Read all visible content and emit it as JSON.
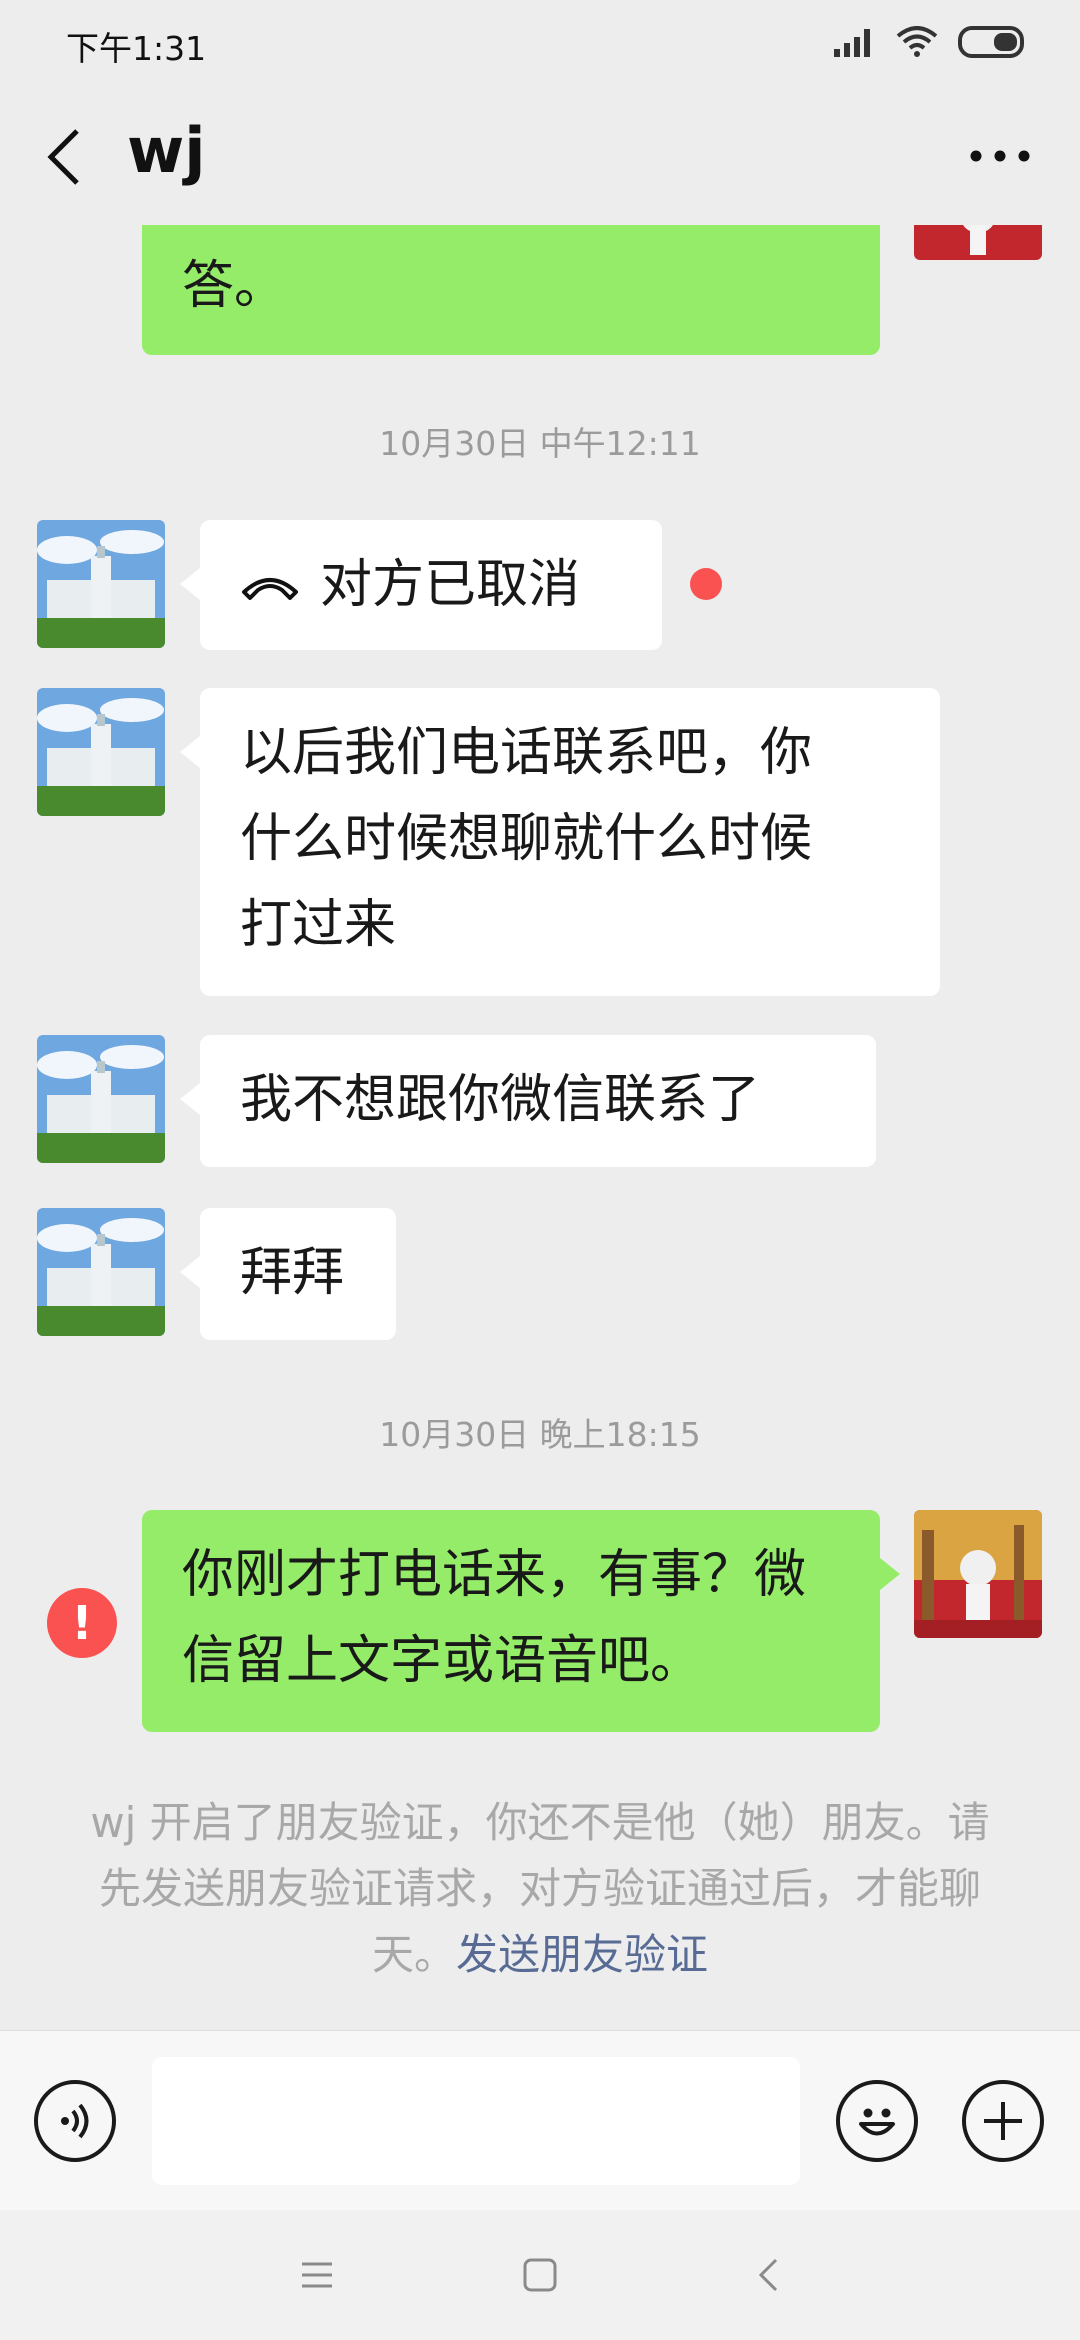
{
  "status_bar": {
    "time": "下午1:31"
  },
  "header": {
    "title": "wj"
  },
  "messages": {
    "top_partial": "答。",
    "ts1": "10月30日 中午12:11",
    "call": "对方已取消",
    "msg1_line1": "以后我们电话联系吧，你",
    "msg1_line2": "什么时候想聊就什么时候",
    "msg1_line3": "打过来",
    "msg2": "我不想跟你微信联系了",
    "msg3": "拜拜",
    "ts2": "10月30日 晚上18:15",
    "out1_line1": "你刚才打电话来，有事？微",
    "out1_line2": "信留上文字或语音吧。",
    "error_mark": "!"
  },
  "system_note": {
    "text": "wj 开启了朋友验证，你还不是他（她）朋友。请先发送朋友验证请求，对方验证通过后，才能聊天。",
    "link": "发送朋友验证"
  },
  "colors": {
    "outgoing_bubble": "#95ec69",
    "incoming_bubble": "#ffffff",
    "background": "#ededed",
    "error_red": "#fa5151",
    "link": "#576b95"
  },
  "icons": {
    "back": "chevron-left-icon",
    "more": "more-icon",
    "voice": "voice-icon",
    "emoji": "emoji-icon",
    "plus": "plus-icon",
    "call_ended": "phone-hangup-icon"
  }
}
